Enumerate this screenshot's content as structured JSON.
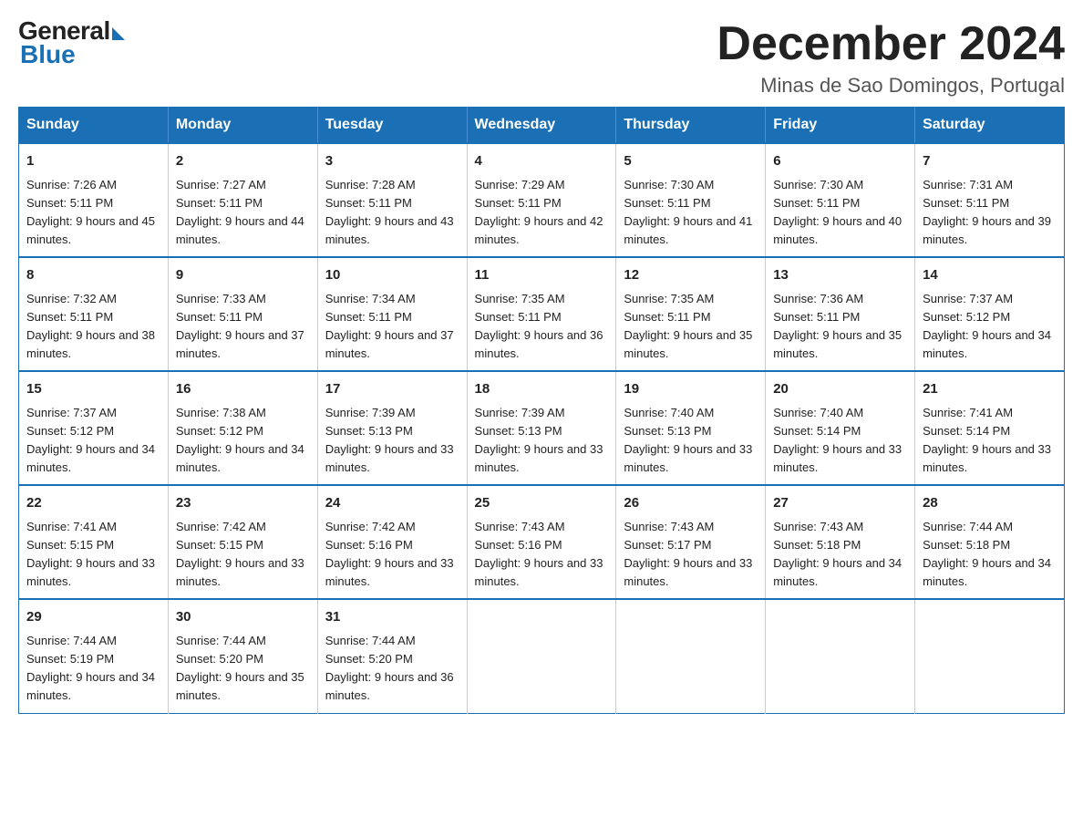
{
  "logo": {
    "general": "General",
    "blue": "Blue"
  },
  "title": "December 2024",
  "subtitle": "Minas de Sao Domingos, Portugal",
  "days_of_week": [
    "Sunday",
    "Monday",
    "Tuesday",
    "Wednesday",
    "Thursday",
    "Friday",
    "Saturday"
  ],
  "weeks": [
    [
      {
        "day": "1",
        "sunrise": "7:26 AM",
        "sunset": "5:11 PM",
        "daylight": "9 hours and 45 minutes."
      },
      {
        "day": "2",
        "sunrise": "7:27 AM",
        "sunset": "5:11 PM",
        "daylight": "9 hours and 44 minutes."
      },
      {
        "day": "3",
        "sunrise": "7:28 AM",
        "sunset": "5:11 PM",
        "daylight": "9 hours and 43 minutes."
      },
      {
        "day": "4",
        "sunrise": "7:29 AM",
        "sunset": "5:11 PM",
        "daylight": "9 hours and 42 minutes."
      },
      {
        "day": "5",
        "sunrise": "7:30 AM",
        "sunset": "5:11 PM",
        "daylight": "9 hours and 41 minutes."
      },
      {
        "day": "6",
        "sunrise": "7:30 AM",
        "sunset": "5:11 PM",
        "daylight": "9 hours and 40 minutes."
      },
      {
        "day": "7",
        "sunrise": "7:31 AM",
        "sunset": "5:11 PM",
        "daylight": "9 hours and 39 minutes."
      }
    ],
    [
      {
        "day": "8",
        "sunrise": "7:32 AM",
        "sunset": "5:11 PM",
        "daylight": "9 hours and 38 minutes."
      },
      {
        "day": "9",
        "sunrise": "7:33 AM",
        "sunset": "5:11 PM",
        "daylight": "9 hours and 37 minutes."
      },
      {
        "day": "10",
        "sunrise": "7:34 AM",
        "sunset": "5:11 PM",
        "daylight": "9 hours and 37 minutes."
      },
      {
        "day": "11",
        "sunrise": "7:35 AM",
        "sunset": "5:11 PM",
        "daylight": "9 hours and 36 minutes."
      },
      {
        "day": "12",
        "sunrise": "7:35 AM",
        "sunset": "5:11 PM",
        "daylight": "9 hours and 35 minutes."
      },
      {
        "day": "13",
        "sunrise": "7:36 AM",
        "sunset": "5:11 PM",
        "daylight": "9 hours and 35 minutes."
      },
      {
        "day": "14",
        "sunrise": "7:37 AM",
        "sunset": "5:12 PM",
        "daylight": "9 hours and 34 minutes."
      }
    ],
    [
      {
        "day": "15",
        "sunrise": "7:37 AM",
        "sunset": "5:12 PM",
        "daylight": "9 hours and 34 minutes."
      },
      {
        "day": "16",
        "sunrise": "7:38 AM",
        "sunset": "5:12 PM",
        "daylight": "9 hours and 34 minutes."
      },
      {
        "day": "17",
        "sunrise": "7:39 AM",
        "sunset": "5:13 PM",
        "daylight": "9 hours and 33 minutes."
      },
      {
        "day": "18",
        "sunrise": "7:39 AM",
        "sunset": "5:13 PM",
        "daylight": "9 hours and 33 minutes."
      },
      {
        "day": "19",
        "sunrise": "7:40 AM",
        "sunset": "5:13 PM",
        "daylight": "9 hours and 33 minutes."
      },
      {
        "day": "20",
        "sunrise": "7:40 AM",
        "sunset": "5:14 PM",
        "daylight": "9 hours and 33 minutes."
      },
      {
        "day": "21",
        "sunrise": "7:41 AM",
        "sunset": "5:14 PM",
        "daylight": "9 hours and 33 minutes."
      }
    ],
    [
      {
        "day": "22",
        "sunrise": "7:41 AM",
        "sunset": "5:15 PM",
        "daylight": "9 hours and 33 minutes."
      },
      {
        "day": "23",
        "sunrise": "7:42 AM",
        "sunset": "5:15 PM",
        "daylight": "9 hours and 33 minutes."
      },
      {
        "day": "24",
        "sunrise": "7:42 AM",
        "sunset": "5:16 PM",
        "daylight": "9 hours and 33 minutes."
      },
      {
        "day": "25",
        "sunrise": "7:43 AM",
        "sunset": "5:16 PM",
        "daylight": "9 hours and 33 minutes."
      },
      {
        "day": "26",
        "sunrise": "7:43 AM",
        "sunset": "5:17 PM",
        "daylight": "9 hours and 33 minutes."
      },
      {
        "day": "27",
        "sunrise": "7:43 AM",
        "sunset": "5:18 PM",
        "daylight": "9 hours and 34 minutes."
      },
      {
        "day": "28",
        "sunrise": "7:44 AM",
        "sunset": "5:18 PM",
        "daylight": "9 hours and 34 minutes."
      }
    ],
    [
      {
        "day": "29",
        "sunrise": "7:44 AM",
        "sunset": "5:19 PM",
        "daylight": "9 hours and 34 minutes."
      },
      {
        "day": "30",
        "sunrise": "7:44 AM",
        "sunset": "5:20 PM",
        "daylight": "9 hours and 35 minutes."
      },
      {
        "day": "31",
        "sunrise": "7:44 AM",
        "sunset": "5:20 PM",
        "daylight": "9 hours and 36 minutes."
      },
      null,
      null,
      null,
      null
    ]
  ]
}
